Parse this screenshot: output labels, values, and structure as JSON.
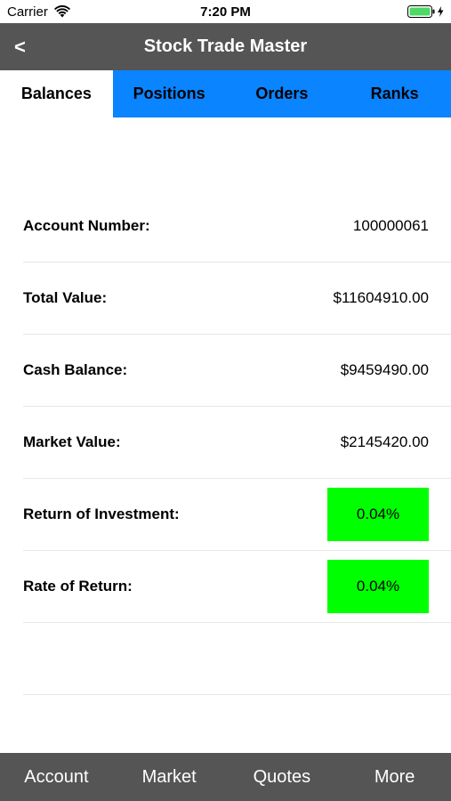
{
  "status_bar": {
    "carrier": "Carrier",
    "time": "7:20 PM"
  },
  "nav": {
    "back_label": "<",
    "title": "Stock Trade Master"
  },
  "tabs": [
    {
      "label": "Balances",
      "active": true
    },
    {
      "label": "Positions",
      "active": false
    },
    {
      "label": "Orders",
      "active": false
    },
    {
      "label": "Ranks",
      "active": false
    }
  ],
  "balances": {
    "account_number": {
      "label": "Account Number:",
      "value": "100000061"
    },
    "total_value": {
      "label": "Total Value:",
      "value": "$11604910.00"
    },
    "cash_balance": {
      "label": "Cash Balance:",
      "value": "$9459490.00"
    },
    "market_value": {
      "label": "Market Value:",
      "value": "$2145420.00"
    },
    "return_of_investment": {
      "label": "Return of Investment:",
      "value": "0.04%"
    },
    "rate_of_return": {
      "label": "Rate of Return:",
      "value": "0.04%"
    }
  },
  "bottom_tabs": [
    "Account",
    "Market",
    "Quotes",
    "More"
  ],
  "colors": {
    "nav_bg": "#555555",
    "tab_bar_bg": "#0a84ff",
    "positive_badge": "#00ff00",
    "battery_fill": "#4cd964"
  }
}
